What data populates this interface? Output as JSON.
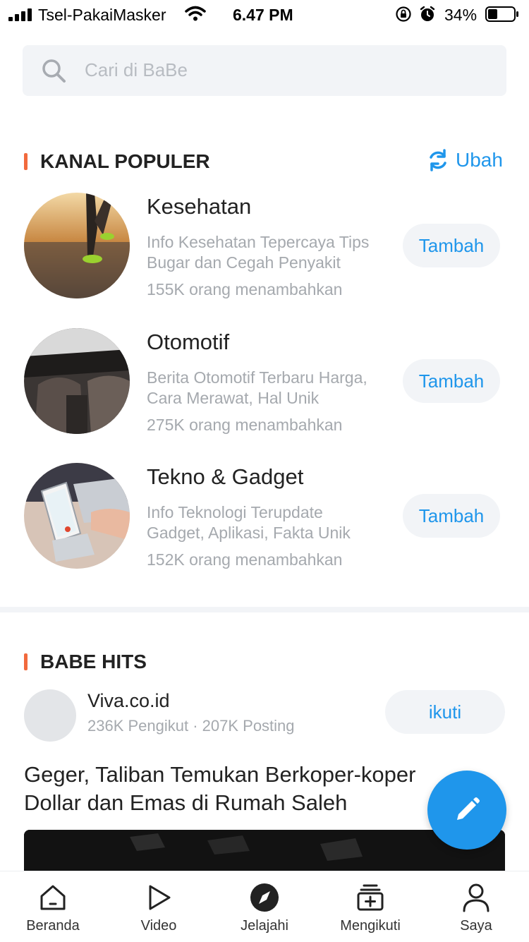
{
  "status_bar": {
    "carrier": "Tsel-PakaiMasker",
    "time": "6.47 PM",
    "battery": "34%"
  },
  "search": {
    "placeholder": "Cari di BaBe"
  },
  "popular": {
    "title": "KANAL POPULER",
    "change_label": "Ubah",
    "channels": [
      {
        "name": "Kesehatan",
        "desc_line1": "Info Kesehatan Tepercaya Tips",
        "desc_line2": "Bugar dan Cegah Penyakit",
        "count": "155K orang menambahkan",
        "button": "Tambah"
      },
      {
        "name": "Otomotif",
        "desc_line1": "Berita Otomotif Terbaru Harga,",
        "desc_line2": "Cara Merawat, Hal Unik",
        "count": "275K orang menambahkan",
        "button": "Tambah"
      },
      {
        "name": "Tekno & Gadget",
        "desc_line1": "Info Teknologi Terupdate",
        "desc_line2": "Gadget, Aplikasi, Fakta Unik",
        "count": "152K orang menambahkan",
        "button": "Tambah"
      }
    ]
  },
  "hits": {
    "title": "BABE HITS",
    "publisher": {
      "name": "Viva.co.id",
      "stats": "236K Pengikut · 207K Posting",
      "follow": "ikuti"
    },
    "headline": "Geger, Taliban Temukan Berkoper-koper Dollar dan Emas di Rumah Saleh"
  },
  "tabs": [
    {
      "label": "Beranda",
      "icon": "home-icon"
    },
    {
      "label": "Video",
      "icon": "play-icon"
    },
    {
      "label": "Jelajahi",
      "icon": "compass-icon"
    },
    {
      "label": "Mengikuti",
      "icon": "add-stack-icon"
    },
    {
      "label": "Saya",
      "icon": "user-icon"
    }
  ],
  "colors": {
    "accent": "#1f96eb",
    "section_marker": "#f26a3d"
  }
}
